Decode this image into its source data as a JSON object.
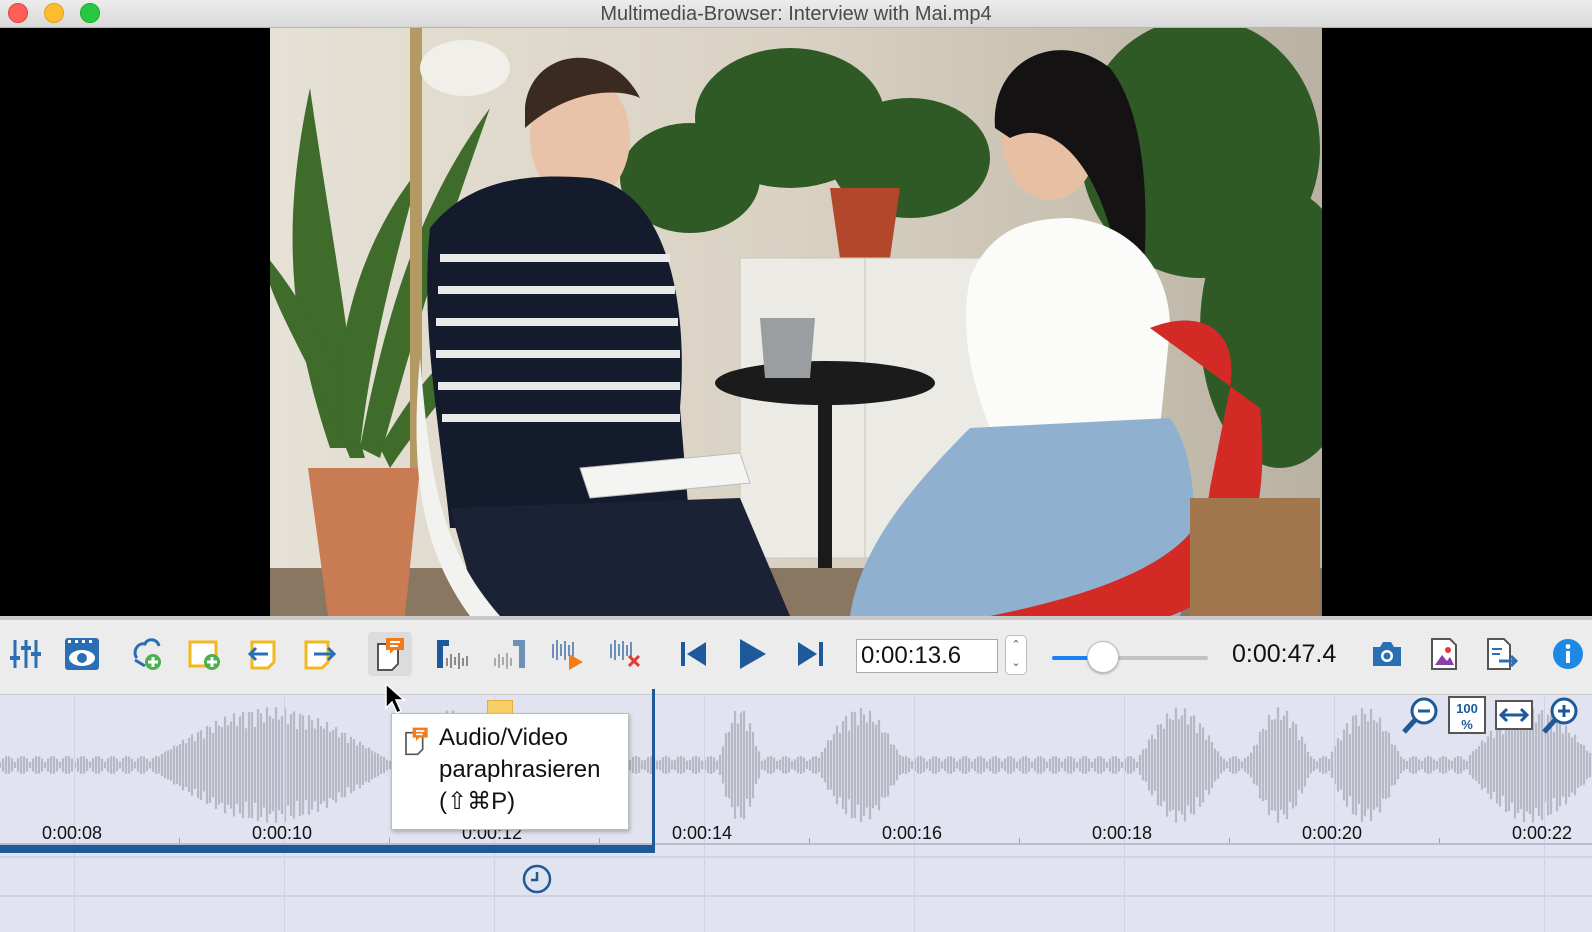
{
  "window": {
    "title": "Multimedia-Browser:  Interview with Mai.mp4"
  },
  "toolbar": {
    "buttons": [
      {
        "name": "settings",
        "icon": "sliders-icon"
      },
      {
        "name": "preview",
        "icon": "film-eye-icon"
      },
      {
        "name": "add-memo-link",
        "icon": "link-add-icon"
      },
      {
        "name": "new-memo",
        "icon": "memo-add-icon"
      },
      {
        "name": "import",
        "icon": "import-icon"
      },
      {
        "name": "export",
        "icon": "export-icon"
      },
      {
        "name": "paraphrase",
        "icon": "paraphrase-icon"
      },
      {
        "name": "set-start",
        "icon": "clip-start-icon"
      },
      {
        "name": "set-end",
        "icon": "clip-end-icon"
      },
      {
        "name": "play-clip",
        "icon": "clip-play-icon"
      },
      {
        "name": "delete-clip",
        "icon": "clip-delete-icon"
      },
      {
        "name": "skip-back",
        "icon": "skip-back-icon"
      },
      {
        "name": "play",
        "icon": "play-icon"
      },
      {
        "name": "skip-forward",
        "icon": "skip-forward-icon"
      },
      {
        "name": "snapshot",
        "icon": "camera-icon"
      },
      {
        "name": "image-export",
        "icon": "image-icon"
      },
      {
        "name": "document-export",
        "icon": "document-export-icon"
      },
      {
        "name": "info",
        "icon": "info-icon"
      }
    ],
    "current_time": "0:00:13.6",
    "stepper_up": "⌃",
    "stepper_down": "⌄",
    "volume_fraction": 0.32,
    "duration": "0:00:47.4",
    "accent_color": "#1a7ff5",
    "icon_blue": "#2a6fb5",
    "icon_yellow": "#f2b81d",
    "icon_orange": "#f27c1b"
  },
  "timeline": {
    "ticks": [
      "0:00:08",
      "0:00:10",
      "0:00:12",
      "0:00:14",
      "0:00:16",
      "0:00:18",
      "0:00:20",
      "0:00:22"
    ],
    "playhead_time": "0:00:13.6",
    "zoom_100_label": "100 %",
    "progress_color": "#1e5a9a"
  },
  "tooltip": {
    "line1": "Audio/Video",
    "line2": "paraphrasieren",
    "line3": "(⇧⌘P)"
  }
}
